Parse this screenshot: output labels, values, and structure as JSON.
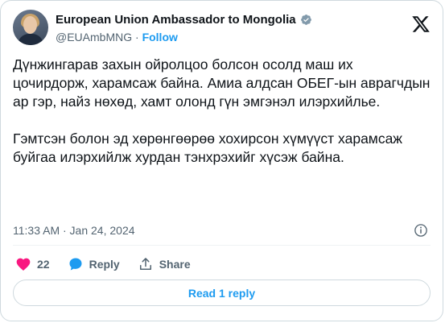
{
  "author": {
    "name": "European Union Ambassador to Mongolia",
    "handle": "@EUAmbMNG",
    "separator": "·",
    "follow_label": "Follow"
  },
  "tweet": {
    "text": "Дүнжингарав захын ойролцоо болсон осолд маш их цочирдорж, харамсаж байна. Амиа алдсан ОБЕГ-ын аврагчдын ар гэр, найз нөхөд, хамт олонд гүн эмгэнэл илэрхийлье.\n\nГэмтсэн болон эд хөрөнгөөрөө хохирсон хүмүүст харамсаж буйгаа илэрхийлж хурдан тэнхрэхийг хүсэж байна.",
    "timestamp": "11:33 AM · Jan 24, 2024"
  },
  "actions": {
    "likes_count": "22",
    "reply_label": "Reply",
    "share_label": "Share"
  },
  "read_replies_label": "Read 1 reply",
  "icons": {
    "verified": "verified-badge-icon",
    "x_logo": "x-logo-icon",
    "info": "info-icon",
    "heart": "heart-icon",
    "reply": "reply-bubble-icon",
    "share": "share-icon"
  },
  "colors": {
    "accent": "#1d9bf0",
    "like": "#f91880",
    "secondary_text": "#536471",
    "border": "#cfd9de"
  }
}
